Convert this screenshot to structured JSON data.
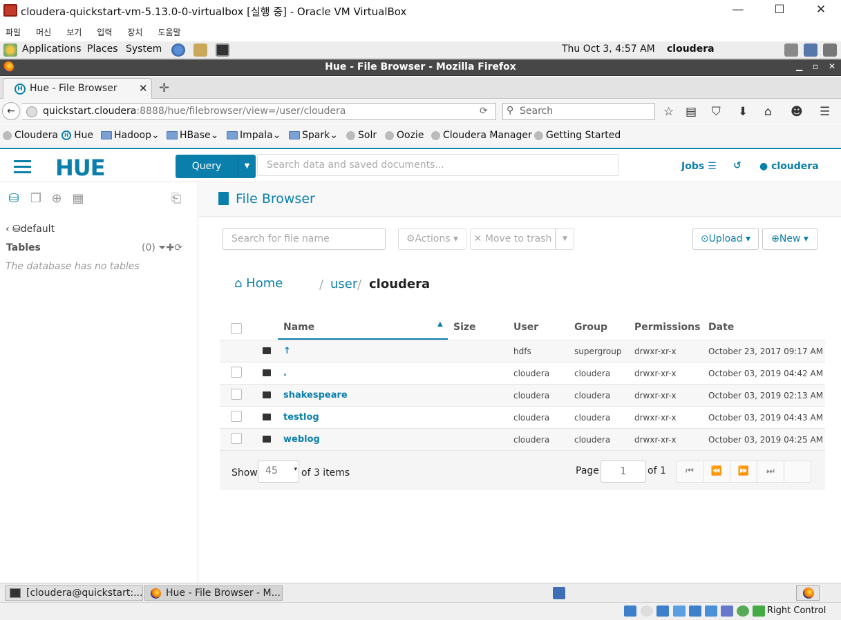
{
  "vbox": {
    "title": "cloudera-quickstart-vm-5.13.0-0-virtualbox [실행 중] - Oracle VM VirtualBox",
    "menu": [
      "파일",
      "머신",
      "보기",
      "입력",
      "장치",
      "도움말"
    ],
    "right_control": "Right Control"
  },
  "gnome": {
    "applications": "Applications",
    "places": "Places",
    "system": "System",
    "datetime": "Thu Oct  3,  4:57 AM",
    "username": "cloudera"
  },
  "firefox": {
    "window_title": "Hue - File Browser - Mozilla Firefox",
    "tab_label": "Hue - File Browser",
    "url_domain": "quickstart.cloudera",
    "url_path": ":8888/hue/filebrowser/view=/user/cloudera",
    "search_placeholder": "Search",
    "bookmarks": [
      "Cloudera",
      "Hue",
      "Hadoop",
      "HBase",
      "Impala",
      "Spark",
      "Solr",
      "Oozie",
      "Cloudera Manager",
      "Getting Started"
    ]
  },
  "hue": {
    "logo": "HUE",
    "query_button": "Query",
    "search_placeholder": "Search data and saved documents...",
    "jobs": "Jobs",
    "user": "cloudera"
  },
  "left": {
    "database": "default",
    "tables_label": "Tables",
    "tables_count": "(0)",
    "empty_msg": "The database has no tables"
  },
  "main": {
    "title": "File Browser",
    "file_search_placeholder": "Search for file name",
    "actions": "Actions",
    "move_to_trash": "Move to trash",
    "upload": "Upload",
    "new": "New",
    "breadcrumb": {
      "home": "Home",
      "user": "user",
      "current": "cloudera"
    },
    "columns": [
      "Name",
      "Size",
      "User",
      "Group",
      "Permissions",
      "Date"
    ],
    "rows": [
      {
        "name": "↑",
        "size": "",
        "user": "hdfs",
        "group": "supergroup",
        "perm": "drwxr-xr-x",
        "date": "October 23, 2017 09:17 AM"
      },
      {
        "name": ".",
        "size": "",
        "user": "cloudera",
        "group": "cloudera",
        "perm": "drwxr-xr-x",
        "date": "October 03, 2019 04:42 AM"
      },
      {
        "name": "shakespeare",
        "size": "",
        "user": "cloudera",
        "group": "cloudera",
        "perm": "drwxr-xr-x",
        "date": "October 03, 2019 02:13 AM"
      },
      {
        "name": "testlog",
        "size": "",
        "user": "cloudera",
        "group": "cloudera",
        "perm": "drwxr-xr-x",
        "date": "October 03, 2019 04:43 AM"
      },
      {
        "name": "weblog",
        "size": "",
        "user": "cloudera",
        "group": "cloudera",
        "perm": "drwxr-xr-x",
        "date": "October 03, 2019 04:25 AM"
      }
    ],
    "show_label": "Show",
    "page_size": "45",
    "of_items": "of 3 items",
    "page_label": "Page",
    "page_value": "1",
    "of_pages": "of 1"
  },
  "taskbar": {
    "terminal": "[cloudera@quickstart:...",
    "firefox": "Hue - File Browser - M..."
  },
  "colors": {
    "accent": "#0b7fab"
  }
}
